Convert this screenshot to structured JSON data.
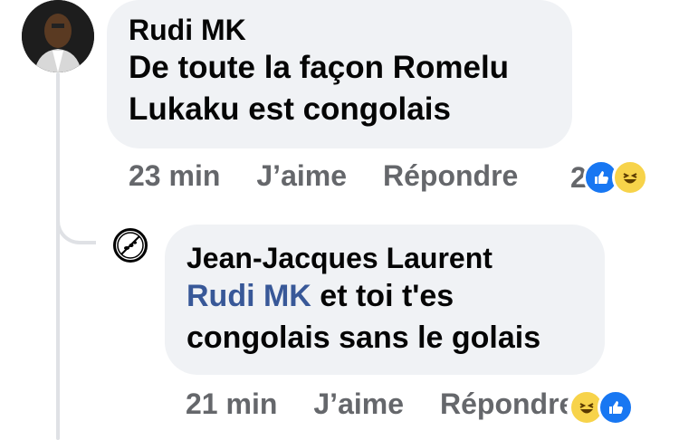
{
  "comment": {
    "author": "Rudi MK",
    "line1": "De toute la façon Romelu",
    "line2": "Lukaku est congolais",
    "time": "23 min",
    "like_label": "J’aime",
    "reply_label": "Répondre",
    "reaction_count": "2",
    "reactions": [
      "like-icon",
      "haha-icon"
    ]
  },
  "reply": {
    "author": "Jean-Jacques Laurent",
    "mention": "Rudi MK",
    "line1_rest": " et toi t'es",
    "line2": "congolais sans le golais",
    "time": "21 min",
    "like_label": "J’aime",
    "reply_label": "Répondre",
    "reactions": [
      "haha-icon",
      "like-icon"
    ]
  },
  "colors": {
    "bubble": "#f0f2f5",
    "mention": "#385898",
    "meta": "#65676b",
    "like": "#1877f2"
  }
}
